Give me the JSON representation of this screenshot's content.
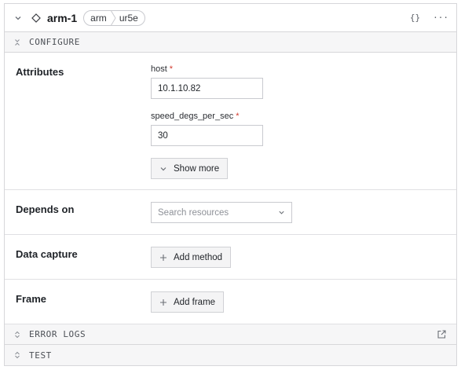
{
  "header": {
    "title": "arm-1",
    "crumbs": [
      "arm",
      "ur5e"
    ],
    "json_button": "{}",
    "menu_button": "···"
  },
  "configure_bar": {
    "label": "CONFIGURE"
  },
  "attributes": {
    "label": "Attributes",
    "host": {
      "label": "host",
      "required": "*",
      "value": "10.1.10.82"
    },
    "speed": {
      "label": "speed_degs_per_sec",
      "required": "*",
      "value": "30"
    },
    "show_more": "Show more"
  },
  "depends_on": {
    "label": "Depends on",
    "placeholder": "Search resources"
  },
  "data_capture": {
    "label": "Data capture",
    "button": "Add method"
  },
  "frame": {
    "label": "Frame",
    "button": "Add frame"
  },
  "error_logs_bar": {
    "label": "ERROR LOGS"
  },
  "test_bar": {
    "label": "TEST"
  },
  "icons": {
    "collapse": "chevron-down-icon",
    "component": "diamond-icon",
    "expand": "caret-updown-icon",
    "external": "external-link-icon",
    "add": "plus-icon"
  }
}
